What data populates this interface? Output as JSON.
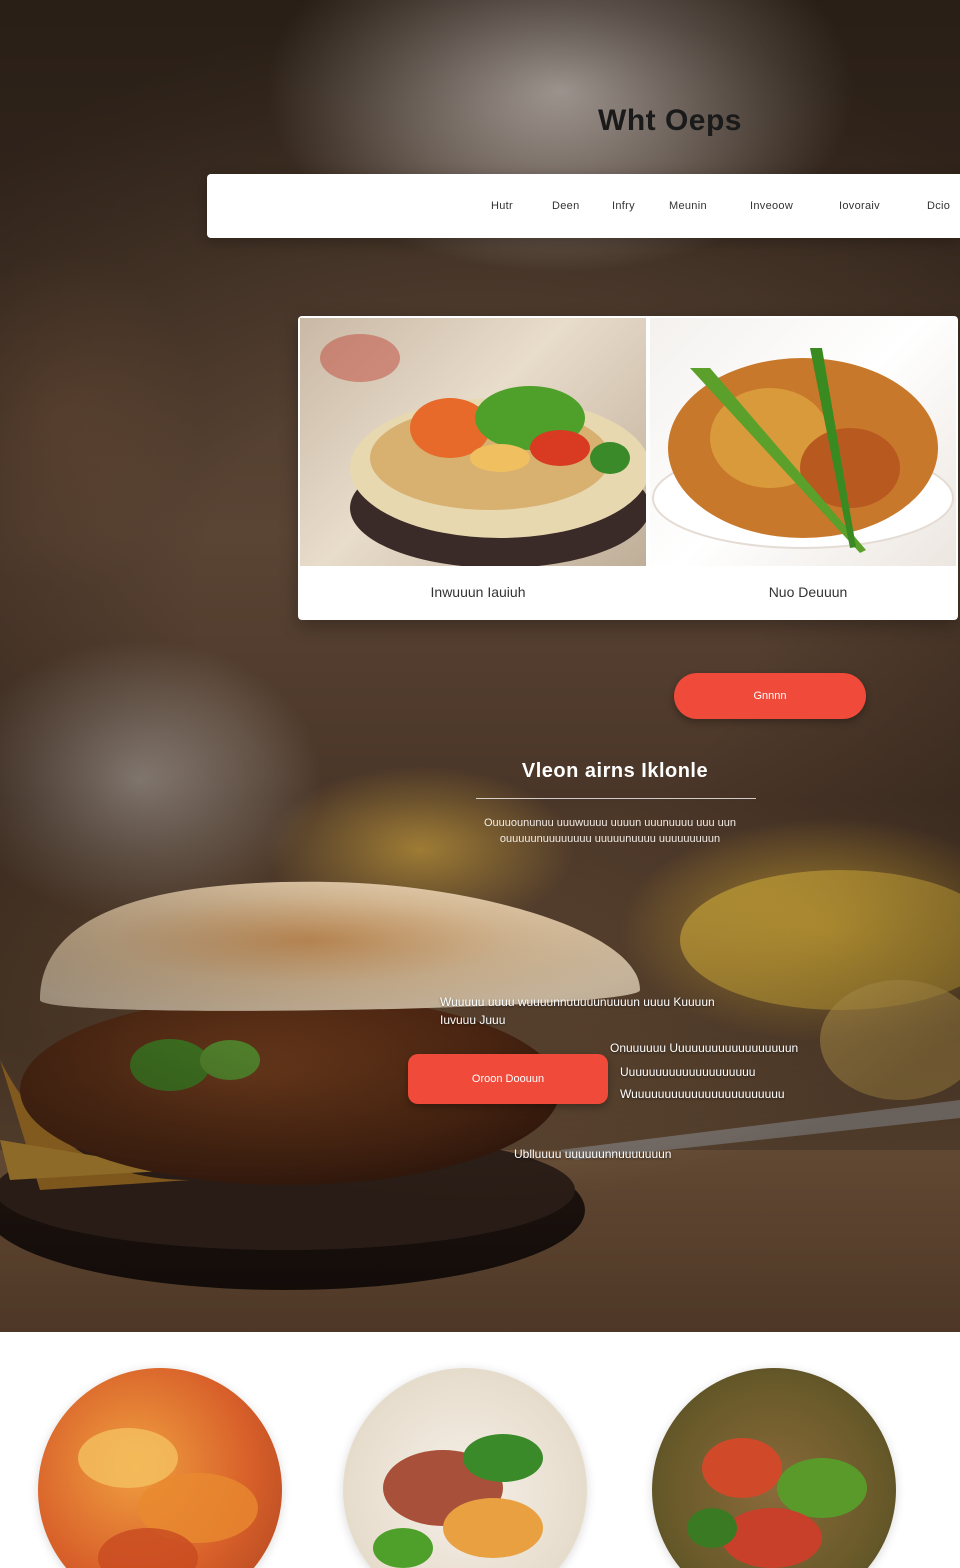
{
  "site": {
    "title": "Wht Oeps"
  },
  "nav": {
    "items": [
      "Hutr",
      "Deen",
      "Infry",
      "Meunin",
      "Inveoow",
      "Iovoraiv",
      "Dcio"
    ]
  },
  "featured": {
    "dishes": [
      {
        "caption": "Inwuuun Iauiuh"
      },
      {
        "caption": "Nuo Deuuun"
      }
    ]
  },
  "cta": {
    "top_button_label": "Gnnnn"
  },
  "section": {
    "heading": "Vleon airns Iklonle",
    "text": "Ouuuoununuu uuuwuuuu uuuun uuunuuuu uuu uun ouuuuunuuuuuuuu uuuuunuuuu uuuuuuuuun"
  },
  "promo": {
    "line1": "Wuuuuu uuuu wuuuunnuuuuunuuuun uuuu Kuuuun",
    "line2": "Iuvuuu Juuu",
    "line3": "Onuuuuuu Uuuuuuuuuuuuuuuuuun",
    "line4": "Uuuuuuuuuuuuuuuuuuuu",
    "line5": "Wuuuuuuuuuuuuuuuuuuuuuuu",
    "button_label": "Oroon Doouun",
    "footnote": "Ublluuuu uuuuuunnuuuuuuun"
  },
  "colors": {
    "accent": "#ef4a3a",
    "nav_background": "#ffffff",
    "title_text": "#1a1a1a"
  }
}
